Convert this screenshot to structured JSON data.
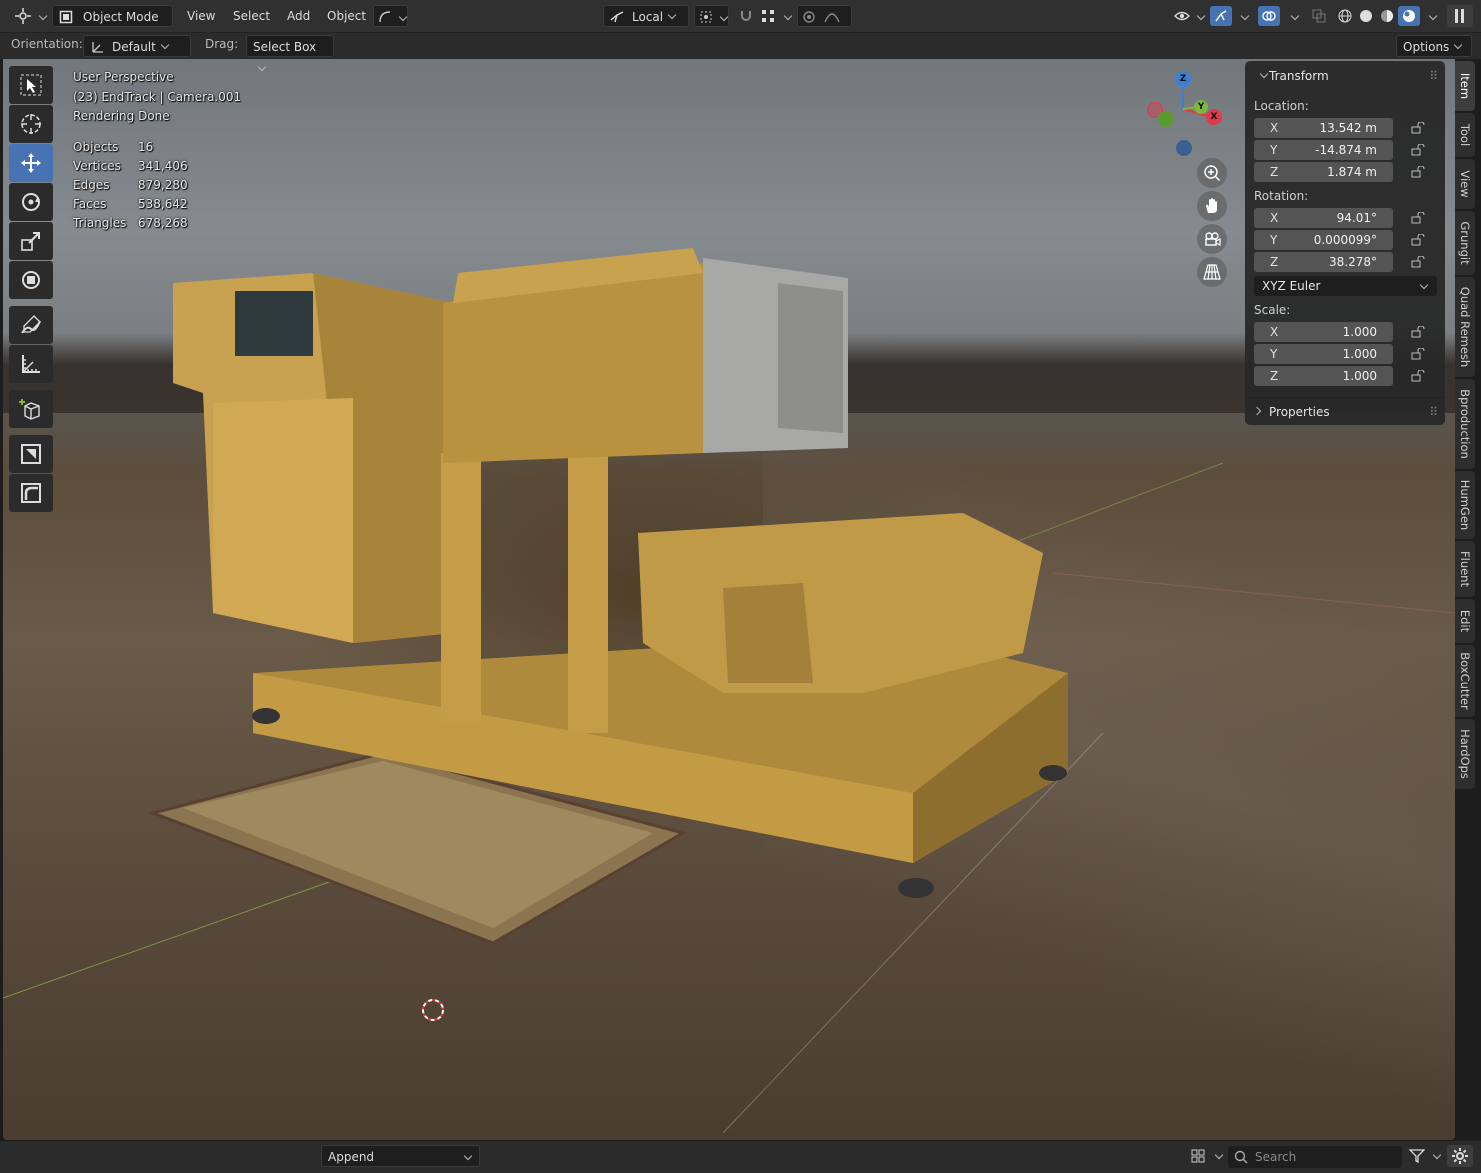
{
  "header": {
    "mode_label": "Object Mode",
    "menus": [
      "View",
      "Select",
      "Add",
      "Object"
    ],
    "transform_orientation_label": "Local"
  },
  "tool_header": {
    "orientation_label": "Orientation:",
    "orientation_value": "Default",
    "drag_label": "Drag:",
    "drag_value": "Select Box",
    "options_label": "Options"
  },
  "viewport_overlay": {
    "view_name": "User Perspective",
    "object_info": "(23) EndTrack | Camera.001",
    "render_status": "Rendering Done",
    "stats": [
      {
        "label": "Objects",
        "value": "16"
      },
      {
        "label": "Vertices",
        "value": "341,406"
      },
      {
        "label": "Edges",
        "value": "879,280"
      },
      {
        "label": "Faces",
        "value": "538,642"
      },
      {
        "label": "Triangles",
        "value": "678,268"
      }
    ]
  },
  "gizmo": {
    "z": "Z",
    "y": "Y",
    "x": "X"
  },
  "npanel": {
    "transform_title": "Transform",
    "location_label": "Location:",
    "location": [
      {
        "axis": "X",
        "value": "13.542 m"
      },
      {
        "axis": "Y",
        "value": "-14.874 m"
      },
      {
        "axis": "Z",
        "value": "1.874 m"
      }
    ],
    "rotation_label": "Rotation:",
    "rotation": [
      {
        "axis": "X",
        "value": "94.01°"
      },
      {
        "axis": "Y",
        "value": "0.000099°"
      },
      {
        "axis": "Z",
        "value": "38.278°"
      }
    ],
    "rotation_mode": "XYZ Euler",
    "scale_label": "Scale:",
    "scale": [
      {
        "axis": "X",
        "value": "1.000"
      },
      {
        "axis": "Y",
        "value": "1.000"
      },
      {
        "axis": "Z",
        "value": "1.000"
      }
    ],
    "properties_title": "Properties"
  },
  "side_tabs": [
    "Item",
    "Tool",
    "View",
    "Grungit",
    "Quad Remesh",
    "Bproduction",
    "HumGen",
    "Fluent",
    "Edit",
    "BoxCutter",
    "HardOps"
  ],
  "status_bar": {
    "append_label": "Append",
    "search_placeholder": "Search"
  },
  "colors": {
    "accent": "#4772b3",
    "axis_x": "#e0394c",
    "axis_y": "#7cb83a",
    "axis_z": "#3b80d6"
  }
}
